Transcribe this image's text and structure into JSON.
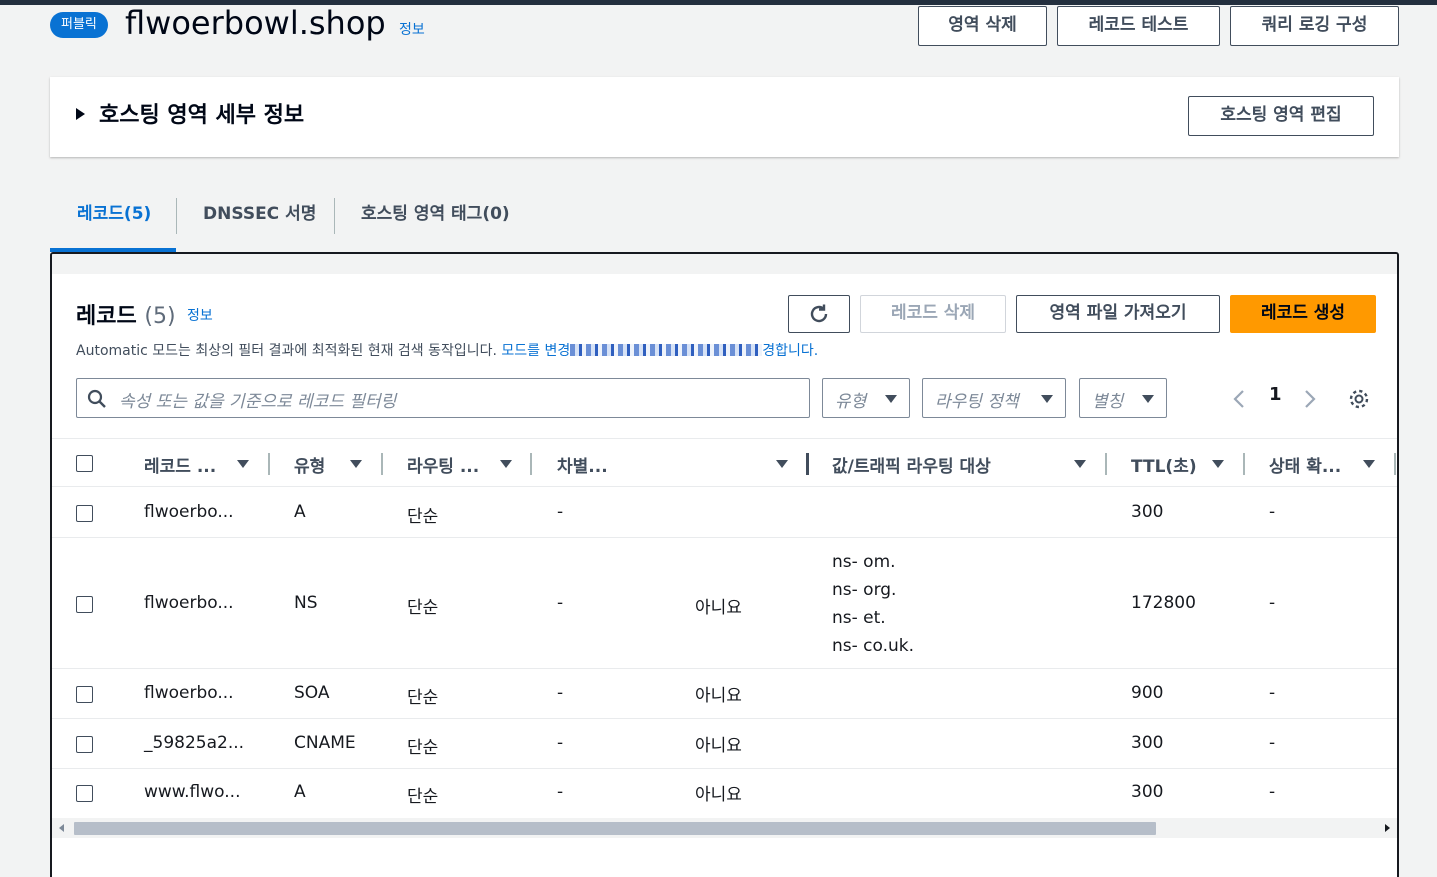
{
  "header": {
    "badge": "퍼블릭",
    "zone_name": "flwoerbowl.shop",
    "info": "정보",
    "buttons": {
      "delete_zone": "영역 삭제",
      "test_record": "레코드 테스트",
      "query_logging": "쿼리 로깅 구성"
    }
  },
  "details_panel": {
    "title": "호스팅 영역 세부 정보",
    "edit_button": "호스팅 영역 편집"
  },
  "tabs": [
    {
      "label": "레코드(5)"
    },
    {
      "label": "DNSSEC 서명"
    },
    {
      "label": "호스팅 영역 태그(0)"
    }
  ],
  "records": {
    "title": "레코드",
    "count": "(5)",
    "info": "정보",
    "buttons": {
      "delete": "레코드 삭제",
      "import": "영역 파일 가져오기",
      "create": "레코드 생성"
    },
    "description": "Automatic 모드는 최상의 필터 결과에 최적화된 현재 검색 동작입니다.",
    "description_link_start": "모드를 변경",
    "description_link_end": "경합니다.",
    "search_placeholder": "속성 또는 값을 기준으로 레코드 필터링",
    "filters": {
      "type": "유형",
      "routing": "라우팅 정책",
      "alias": "별칭"
    },
    "page": "1",
    "columns": {
      "name": "레코드 ...",
      "type": "유형",
      "routing": "라우팅 ...",
      "differentiator": "차별...",
      "alias": "",
      "value": "값/트래픽 라우팅 대상",
      "ttl": "TTL(초)",
      "health": "상태 확..."
    },
    "rows": [
      {
        "name": "flwoerbo...",
        "type": "A",
        "routing": "단순",
        "diff": "-",
        "alias": "",
        "values": [
          ""
        ],
        "ttl": "300",
        "health": "-"
      },
      {
        "name": "flwoerbo...",
        "type": "NS",
        "routing": "단순",
        "diff": "-",
        "alias": "아니요",
        "values": [
          "ns-",
          "ns-",
          "ns-",
          "ns-"
        ],
        "values_tail": [
          "om.",
          "org.",
          "et.",
          "co.uk."
        ],
        "ttl": "172800",
        "health": "-"
      },
      {
        "name": "flwoerbo...",
        "type": "SOA",
        "routing": "단순",
        "diff": "-",
        "alias": "아니요",
        "values": [
          ""
        ],
        "ttl": "900",
        "health": "-"
      },
      {
        "name": "_59825a2...",
        "type": "CNAME",
        "routing": "단순",
        "diff": "-",
        "alias": "아니요",
        "values": [
          ""
        ],
        "ttl": "300",
        "health": "-"
      },
      {
        "name": "www.flwo...",
        "type": "A",
        "routing": "단순",
        "diff": "-",
        "alias": "아니요",
        "values": [
          ""
        ],
        "ttl": "300",
        "health": "-"
      }
    ]
  },
  "colors": {
    "accent": "#0972d3",
    "primary_button": "#ff9900",
    "text": "#16191f"
  },
  "icons": [
    "refresh-icon",
    "search-icon",
    "settings-gear-icon",
    "chevron-left-icon",
    "chevron-right-icon"
  ]
}
